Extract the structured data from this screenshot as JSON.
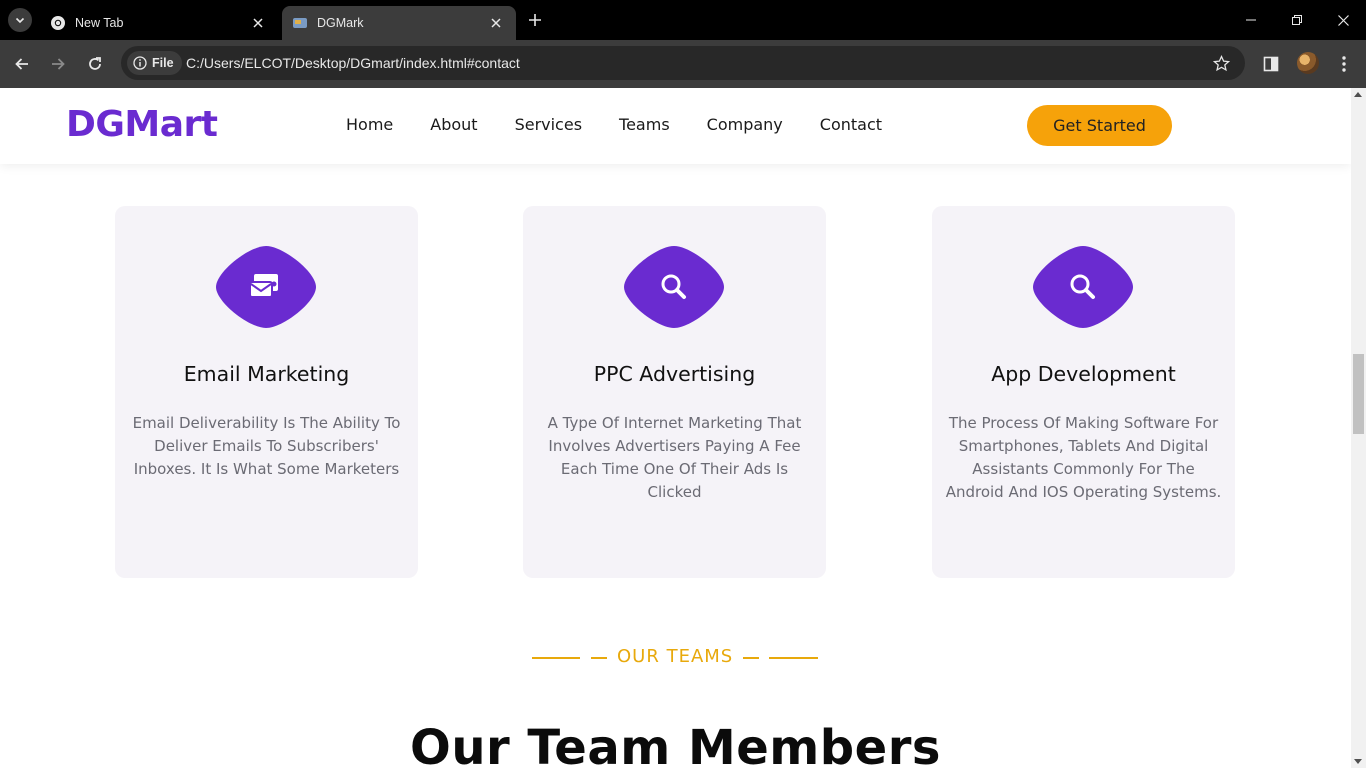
{
  "browser": {
    "tabs": [
      {
        "title": "New Tab",
        "active": false
      },
      {
        "title": "DGMark",
        "active": true
      }
    ],
    "address": {
      "scheme_chip": "File",
      "url": "C:/Users/ELCOT/Desktop/DGmart/index.html#contact"
    }
  },
  "site": {
    "logo": "DGMart",
    "nav": [
      "Home",
      "About",
      "Services",
      "Teams",
      "Company",
      "Contact"
    ],
    "cta_label": "Get Started",
    "colors": {
      "brand": "#6a2bd0",
      "accent": "#f6a20a",
      "card_bg": "#f5f3f8"
    }
  },
  "services": [
    {
      "title": "Email Marketing",
      "icon": "mail-icon",
      "lines": [
        "Email Deliverability Is The Ability To",
        "Deliver Emails To Subscribers'",
        "Inboxes. It Is What Some Marketers"
      ]
    },
    {
      "title": "PPC Advertising",
      "icon": "search-icon",
      "lines": [
        "A Type Of Internet Marketing That",
        "Involves Advertisers Paying A Fee",
        "Each Time One Of Their Ads Is Clicked"
      ]
    },
    {
      "title": "App Development",
      "icon": "search-icon",
      "lines": [
        "The Process Of Making Software For",
        "Smartphones, Tablets And Digital",
        "Assistants Commonly For The",
        "Android And IOS Operating Systems."
      ]
    }
  ],
  "teams": {
    "subtitle": "OUR TEAMS",
    "title": "Our Team Members"
  }
}
